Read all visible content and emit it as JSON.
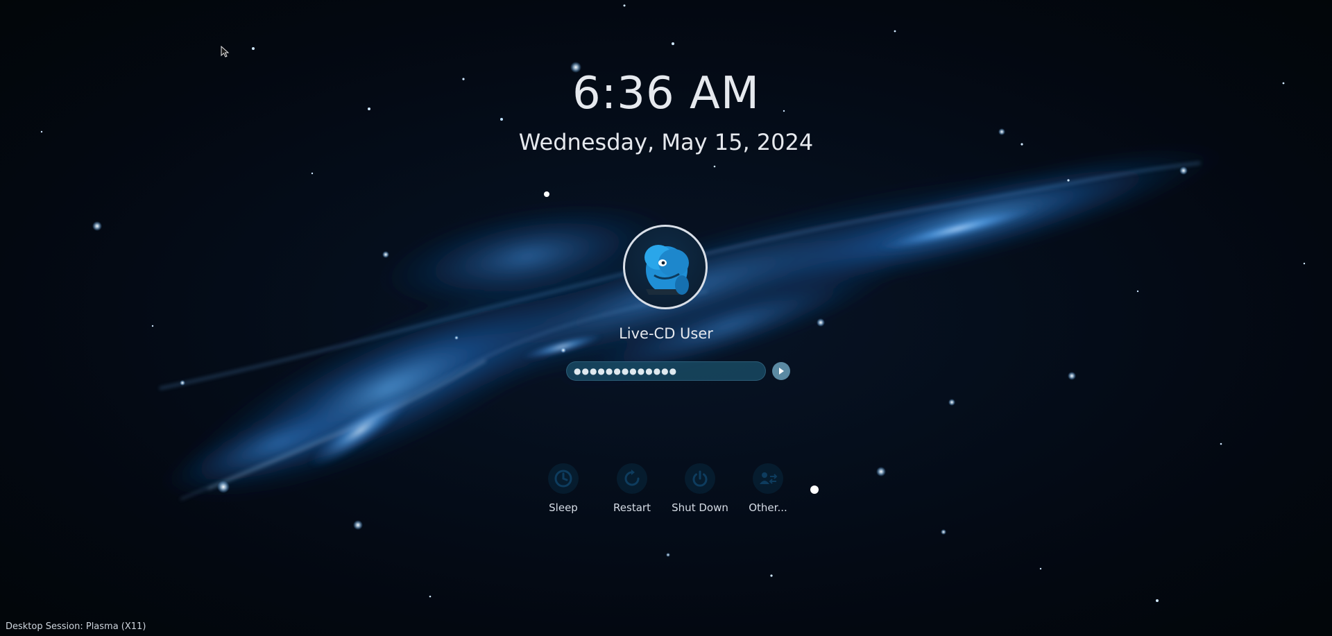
{
  "clock": {
    "time": "6:36 AM",
    "date": "Wednesday, May 15, 2024"
  },
  "user": {
    "name": "Live-CD User",
    "avatar_icon": "mascot-avatar-icon"
  },
  "password": {
    "masked_value": "●●●●●●●●●●●●●"
  },
  "login_button": {
    "icon": "arrow-right-icon"
  },
  "actions": [
    {
      "label": "Sleep",
      "icon": "sleep-icon"
    },
    {
      "label": "Restart",
      "icon": "restart-icon"
    },
    {
      "label": "Shut Down",
      "icon": "power-icon"
    },
    {
      "label": "Other...",
      "icon": "switch-user-icon"
    }
  ],
  "session": {
    "label": "Desktop Session: Plasma (X11)"
  },
  "colors": {
    "background": "#040a14",
    "nebula": "#1e6fc0",
    "text": "#e6e9ee",
    "field": "#1a4e68",
    "accent_button": "#5b8aa3"
  }
}
